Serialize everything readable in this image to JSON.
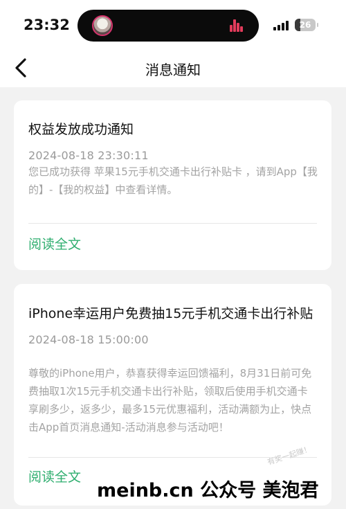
{
  "status_bar": {
    "time": "23:32",
    "battery_level": "26",
    "battery_fraction": 0.26
  },
  "nav": {
    "title": "消息通知",
    "back_icon": "chevron-left-icon"
  },
  "notifications": [
    {
      "title": "权益发放成功通知",
      "time": "2024-08-18 23:30:11",
      "body": "您已成功获得 苹果15元手机交通卡出行补贴卡 ，请到App【我的】-【我的权益】中查看详情。",
      "read_more": "阅读全文"
    },
    {
      "title": "iPhone幸运用户免费抽15元手机交通卡出行补贴",
      "time": "2024-08-18 15:00:00",
      "body": "尊敬的iPhone用户，恭喜获得幸运回馈福利，8月31日前可免费抽取1次15元手机交通卡出行补贴，领取后使用手机交通卡享刷多少，返多少，最多15元优惠福利，活动满额为止，快点击App首页消息通知-活动消息参与活动吧！",
      "read_more": "阅读全文"
    }
  ],
  "watermark": {
    "text": "meinb.cn 公众号 美泡君",
    "faint": "有奖一起赚！"
  },
  "colors": {
    "accent_green": "#2fae6f",
    "island_bars": "#e23b5b"
  }
}
